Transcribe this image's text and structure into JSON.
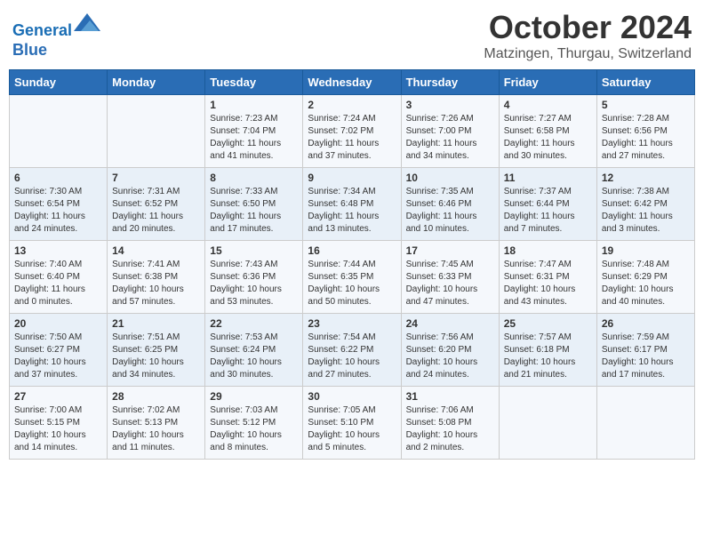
{
  "header": {
    "logo_line1": "General",
    "logo_line2": "Blue",
    "month_title": "October 2024",
    "location": "Matzingen, Thurgau, Switzerland"
  },
  "days_of_week": [
    "Sunday",
    "Monday",
    "Tuesday",
    "Wednesday",
    "Thursday",
    "Friday",
    "Saturday"
  ],
  "weeks": [
    [
      {
        "day": "",
        "info": ""
      },
      {
        "day": "",
        "info": ""
      },
      {
        "day": "1",
        "info": "Sunrise: 7:23 AM\nSunset: 7:04 PM\nDaylight: 11 hours and 41 minutes."
      },
      {
        "day": "2",
        "info": "Sunrise: 7:24 AM\nSunset: 7:02 PM\nDaylight: 11 hours and 37 minutes."
      },
      {
        "day": "3",
        "info": "Sunrise: 7:26 AM\nSunset: 7:00 PM\nDaylight: 11 hours and 34 minutes."
      },
      {
        "day": "4",
        "info": "Sunrise: 7:27 AM\nSunset: 6:58 PM\nDaylight: 11 hours and 30 minutes."
      },
      {
        "day": "5",
        "info": "Sunrise: 7:28 AM\nSunset: 6:56 PM\nDaylight: 11 hours and 27 minutes."
      }
    ],
    [
      {
        "day": "6",
        "info": "Sunrise: 7:30 AM\nSunset: 6:54 PM\nDaylight: 11 hours and 24 minutes."
      },
      {
        "day": "7",
        "info": "Sunrise: 7:31 AM\nSunset: 6:52 PM\nDaylight: 11 hours and 20 minutes."
      },
      {
        "day": "8",
        "info": "Sunrise: 7:33 AM\nSunset: 6:50 PM\nDaylight: 11 hours and 17 minutes."
      },
      {
        "day": "9",
        "info": "Sunrise: 7:34 AM\nSunset: 6:48 PM\nDaylight: 11 hours and 13 minutes."
      },
      {
        "day": "10",
        "info": "Sunrise: 7:35 AM\nSunset: 6:46 PM\nDaylight: 11 hours and 10 minutes."
      },
      {
        "day": "11",
        "info": "Sunrise: 7:37 AM\nSunset: 6:44 PM\nDaylight: 11 hours and 7 minutes."
      },
      {
        "day": "12",
        "info": "Sunrise: 7:38 AM\nSunset: 6:42 PM\nDaylight: 11 hours and 3 minutes."
      }
    ],
    [
      {
        "day": "13",
        "info": "Sunrise: 7:40 AM\nSunset: 6:40 PM\nDaylight: 11 hours and 0 minutes."
      },
      {
        "day": "14",
        "info": "Sunrise: 7:41 AM\nSunset: 6:38 PM\nDaylight: 10 hours and 57 minutes."
      },
      {
        "day": "15",
        "info": "Sunrise: 7:43 AM\nSunset: 6:36 PM\nDaylight: 10 hours and 53 minutes."
      },
      {
        "day": "16",
        "info": "Sunrise: 7:44 AM\nSunset: 6:35 PM\nDaylight: 10 hours and 50 minutes."
      },
      {
        "day": "17",
        "info": "Sunrise: 7:45 AM\nSunset: 6:33 PM\nDaylight: 10 hours and 47 minutes."
      },
      {
        "day": "18",
        "info": "Sunrise: 7:47 AM\nSunset: 6:31 PM\nDaylight: 10 hours and 43 minutes."
      },
      {
        "day": "19",
        "info": "Sunrise: 7:48 AM\nSunset: 6:29 PM\nDaylight: 10 hours and 40 minutes."
      }
    ],
    [
      {
        "day": "20",
        "info": "Sunrise: 7:50 AM\nSunset: 6:27 PM\nDaylight: 10 hours and 37 minutes."
      },
      {
        "day": "21",
        "info": "Sunrise: 7:51 AM\nSunset: 6:25 PM\nDaylight: 10 hours and 34 minutes."
      },
      {
        "day": "22",
        "info": "Sunrise: 7:53 AM\nSunset: 6:24 PM\nDaylight: 10 hours and 30 minutes."
      },
      {
        "day": "23",
        "info": "Sunrise: 7:54 AM\nSunset: 6:22 PM\nDaylight: 10 hours and 27 minutes."
      },
      {
        "day": "24",
        "info": "Sunrise: 7:56 AM\nSunset: 6:20 PM\nDaylight: 10 hours and 24 minutes."
      },
      {
        "day": "25",
        "info": "Sunrise: 7:57 AM\nSunset: 6:18 PM\nDaylight: 10 hours and 21 minutes."
      },
      {
        "day": "26",
        "info": "Sunrise: 7:59 AM\nSunset: 6:17 PM\nDaylight: 10 hours and 17 minutes."
      }
    ],
    [
      {
        "day": "27",
        "info": "Sunrise: 7:00 AM\nSunset: 5:15 PM\nDaylight: 10 hours and 14 minutes."
      },
      {
        "day": "28",
        "info": "Sunrise: 7:02 AM\nSunset: 5:13 PM\nDaylight: 10 hours and 11 minutes."
      },
      {
        "day": "29",
        "info": "Sunrise: 7:03 AM\nSunset: 5:12 PM\nDaylight: 10 hours and 8 minutes."
      },
      {
        "day": "30",
        "info": "Sunrise: 7:05 AM\nSunset: 5:10 PM\nDaylight: 10 hours and 5 minutes."
      },
      {
        "day": "31",
        "info": "Sunrise: 7:06 AM\nSunset: 5:08 PM\nDaylight: 10 hours and 2 minutes."
      },
      {
        "day": "",
        "info": ""
      },
      {
        "day": "",
        "info": ""
      }
    ]
  ]
}
